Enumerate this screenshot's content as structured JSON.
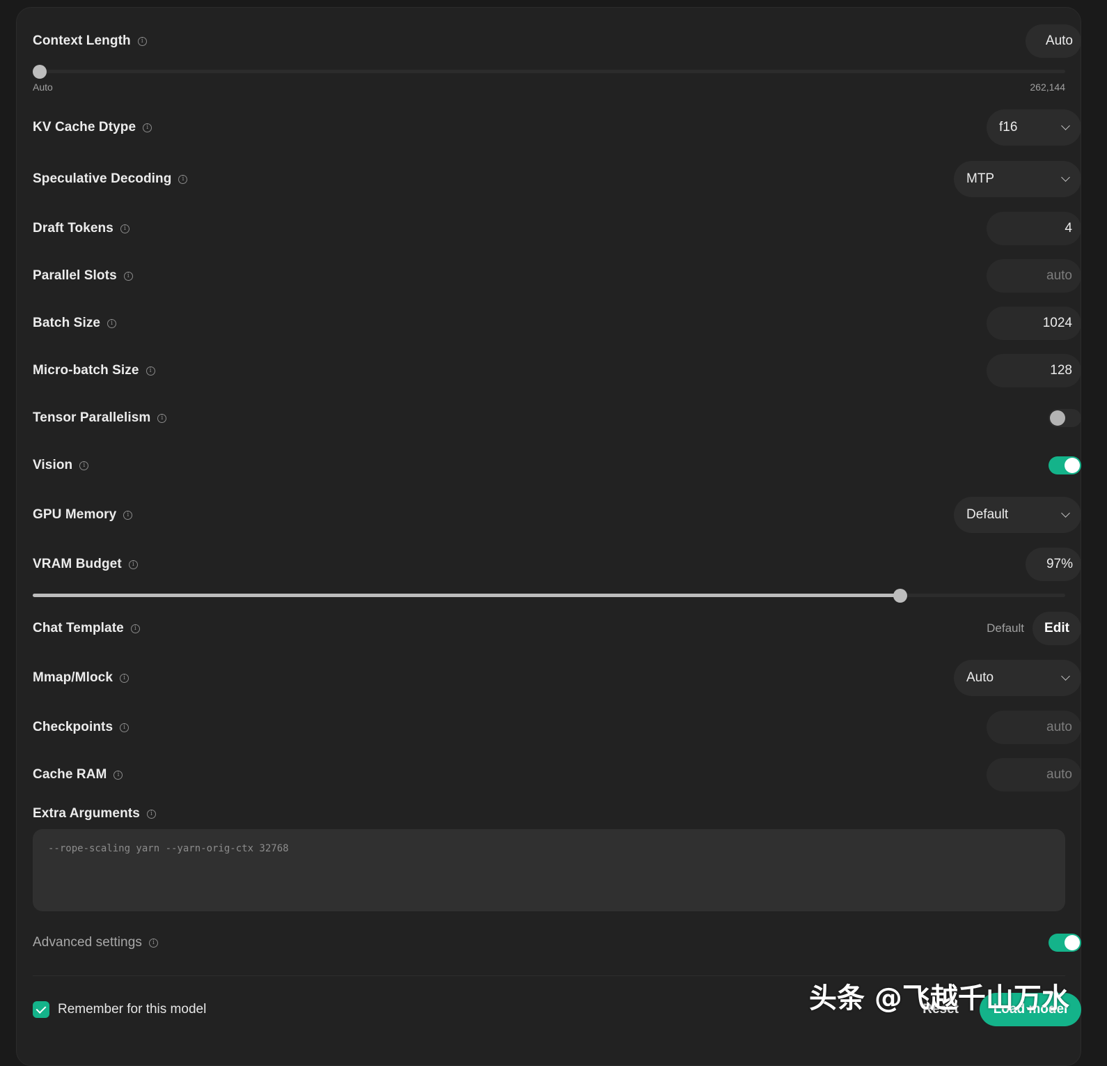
{
  "context_length": {
    "label": "Context Length",
    "value": "Auto",
    "min_label": "Auto",
    "max_label": "262,144",
    "level": 0.0
  },
  "kv_cache_dtype": {
    "label": "KV Cache Dtype",
    "value": "f16"
  },
  "speculative_decoding": {
    "label": "Speculative Decoding",
    "value": "MTP"
  },
  "draft_tokens": {
    "label": "Draft Tokens",
    "value": "4"
  },
  "parallel_slots": {
    "label": "Parallel Slots",
    "placeholder": "auto"
  },
  "batch_size": {
    "label": "Batch Size",
    "value": "1024"
  },
  "micro_batch_size": {
    "label": "Micro-batch Size",
    "value": "128"
  },
  "tensor_parallelism": {
    "label": "Tensor Parallelism",
    "enabled": false
  },
  "vision": {
    "label": "Vision",
    "enabled": true
  },
  "gpu_memory": {
    "label": "GPU Memory",
    "value": "Default"
  },
  "vram_budget": {
    "label": "VRAM Budget",
    "value": "97%",
    "level": 0.845
  },
  "chat_template": {
    "label": "Chat Template",
    "value": "Default",
    "edit_label": "Edit"
  },
  "mmap_mlock": {
    "label": "Mmap/Mlock",
    "value": "Auto"
  },
  "checkpoints": {
    "label": "Checkpoints",
    "placeholder": "auto"
  },
  "cache_ram": {
    "label": "Cache RAM",
    "placeholder": "auto"
  },
  "extra_arguments": {
    "label": "Extra Arguments",
    "value": "--rope-scaling yarn --yarn-orig-ctx 32768"
  },
  "advanced_settings": {
    "label": "Advanced settings",
    "enabled": true
  },
  "footer": {
    "remember_label": "Remember for this model",
    "remember_checked": true,
    "reset_label": "Reset",
    "load_label": "Load model"
  },
  "watermark": "头条 @飞越千山万水",
  "colors": {
    "accent": "#14b38a",
    "panel": "#222222",
    "control": "#2c2c2c"
  }
}
